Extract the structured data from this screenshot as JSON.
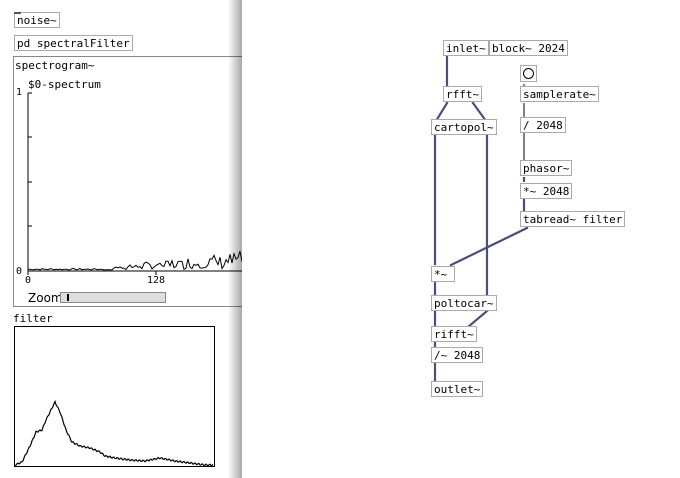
{
  "left_patch": {
    "objects": {
      "noise": "noise~",
      "pd": "pd spectralFilter"
    },
    "spectrogram": {
      "title": "spectrogram~",
      "array_name": "$0-spectrum",
      "y_top": "1",
      "y_bottom": "0",
      "x_tick_0": "0",
      "x_tick_128": "128",
      "zoom_label": "Zoom",
      "zoom_value": 0.06
    },
    "filter": {
      "title": "filter"
    }
  },
  "right_patch": {
    "objects": {
      "inlet": "inlet~",
      "block": "block~ 2024",
      "samplerate": "samplerate~",
      "div2048": "/ 2048",
      "rfft": "rfft~",
      "cartopol": "cartopol~",
      "phasor": "phasor~",
      "mul2048": "*~ 2048",
      "tabread": "tabread~ filter",
      "mul": "*~",
      "poltocar": "poltocar~",
      "rifft": "rifft~",
      "divsig2048": "/~ 2048",
      "outlet": "outlet~"
    }
  },
  "colors": {
    "wire": "#4a4f7a",
    "box_border": "#aaaaaa"
  }
}
